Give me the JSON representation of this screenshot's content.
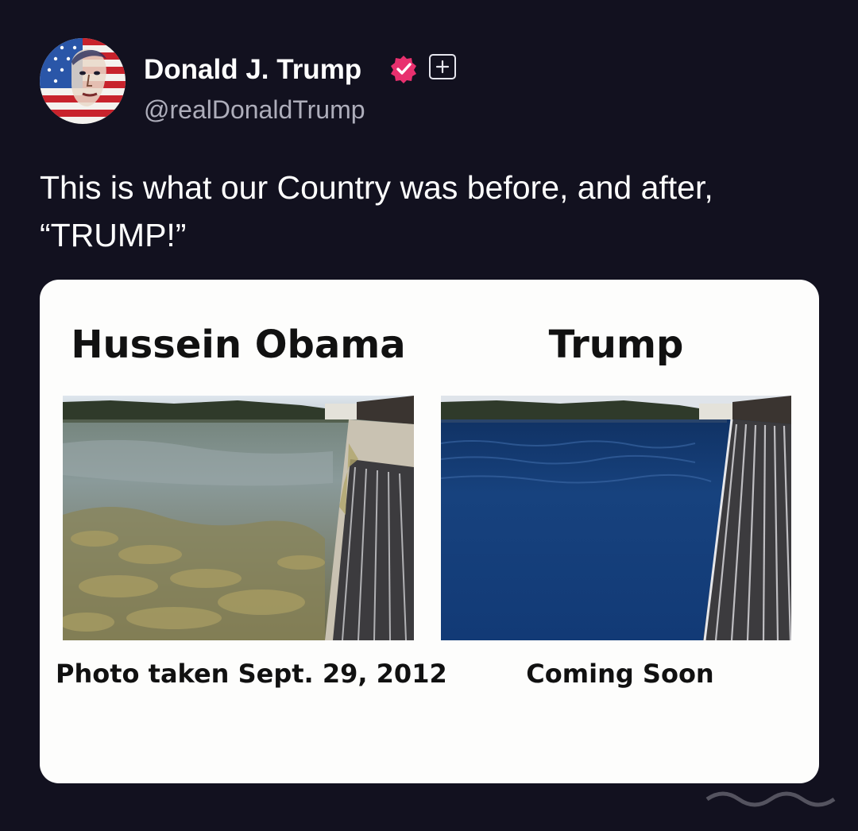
{
  "post": {
    "author": {
      "display_name": "Donald J. Trump",
      "handle": "@realDonaldTrump",
      "verified_icon": "verified-check-icon",
      "follow_icon": "plus-icon"
    },
    "text": "This is what our Country was before, and after, “TRUMP!”",
    "image_card": {
      "left_title": "Hussein Obama",
      "right_title": "Trump",
      "left_caption": "Photo taken Sept. 29, 2012",
      "right_caption": "Coming Soon"
    }
  },
  "colors": {
    "background": "#12111f",
    "verified_badge": "#e8306e",
    "card_background": "#fdfdfc"
  }
}
